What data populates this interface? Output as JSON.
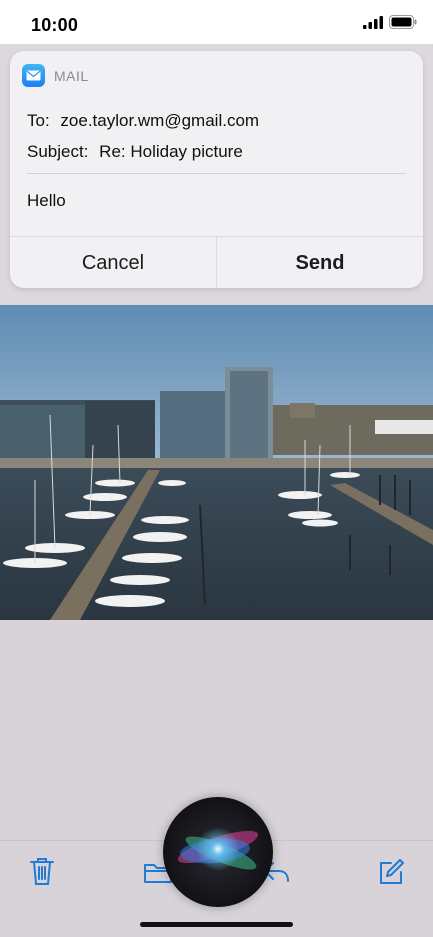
{
  "status_bar": {
    "time": "10:00"
  },
  "notification": {
    "app_name": "MAIL",
    "to_label": "To:",
    "to_value": "zoe.taylor.wm@gmail.com",
    "subject_label": "Subject:",
    "subject_value": "Re: Holiday picture",
    "body": "Hello",
    "cancel_label": "Cancel",
    "send_label": "Send"
  },
  "toolbar": {
    "icons": [
      "trash-icon",
      "folder-icon",
      "reply-icon",
      "compose-icon"
    ]
  },
  "colors": {
    "accent": "#1f7bd6",
    "card_bg": "#f1f0f2",
    "screen_bg": "#d9d5da"
  }
}
